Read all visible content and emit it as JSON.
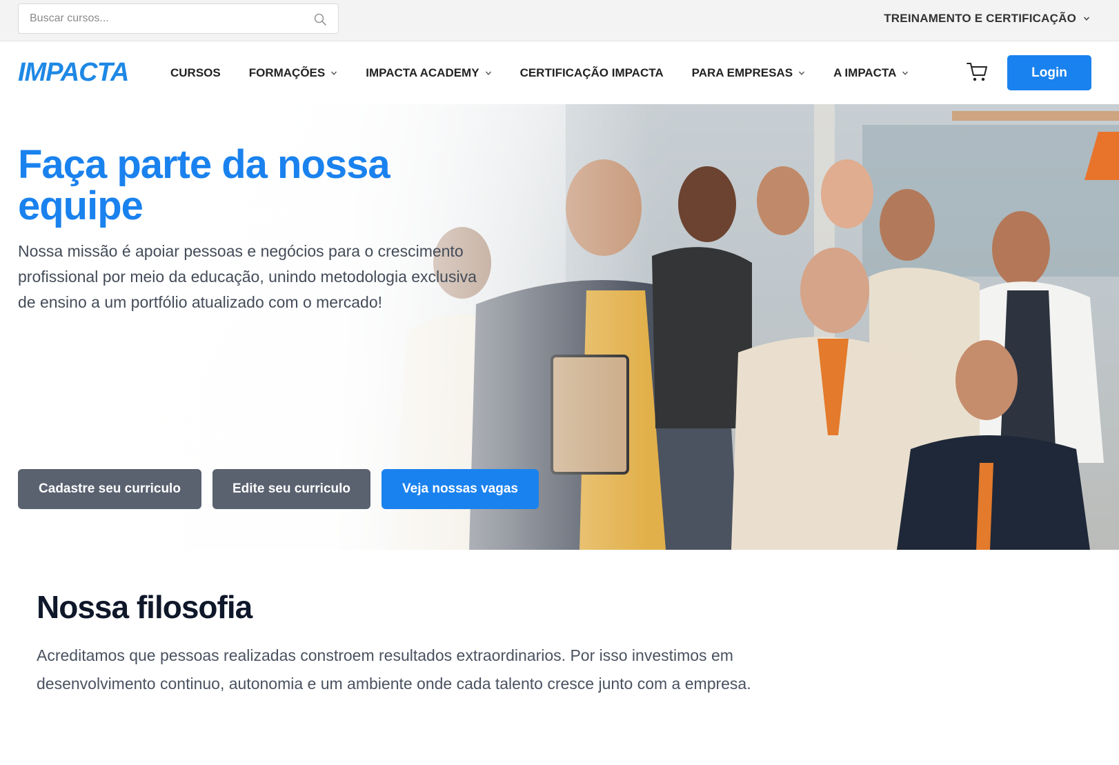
{
  "topbar": {
    "search_placeholder": "Buscar cursos...",
    "treinamento_label": "TREINAMENTO E CERTIFICAÇÃO"
  },
  "nav": {
    "logo": "IMPACTA",
    "items": [
      {
        "label": "CURSOS",
        "dropdown": false
      },
      {
        "label": "FORMAÇÕES",
        "dropdown": true
      },
      {
        "label": "IMPACTA ACADEMY",
        "dropdown": true
      },
      {
        "label": "CERTIFICAÇÃO IMPACTA",
        "dropdown": false
      },
      {
        "label": "PARA EMPRESAS",
        "dropdown": true
      },
      {
        "label": "A IMPACTA",
        "dropdown": true
      }
    ],
    "login_label": "Login"
  },
  "hero": {
    "title": "Faça parte da nossa equipe",
    "description": "Nossa missão é apoiar pessoas e negócios para o crescimento profissional por meio da educação, unindo metodologia exclusiva de ensino a um portfólio atualizado com o mercado!",
    "buttons": {
      "cadastre": "Cadastre seu curriculo",
      "edite": "Edite seu curriculo",
      "vagas": "Veja nossas vagas"
    }
  },
  "filosofia": {
    "title": "Nossa filosofia",
    "text": "Acreditamos que pessoas realizadas constroem resultados extraordinarios. Por isso investimos em desenvolvimento continuo, autonomia e um ambiente onde cada talento cresce junto com a empresa."
  },
  "colors": {
    "brand_blue": "#1a82ee",
    "button_gray": "#5a6270",
    "heading_dark": "#0f172a"
  },
  "icons": [
    "search-icon",
    "chevron-down-icon",
    "cart-icon"
  ]
}
